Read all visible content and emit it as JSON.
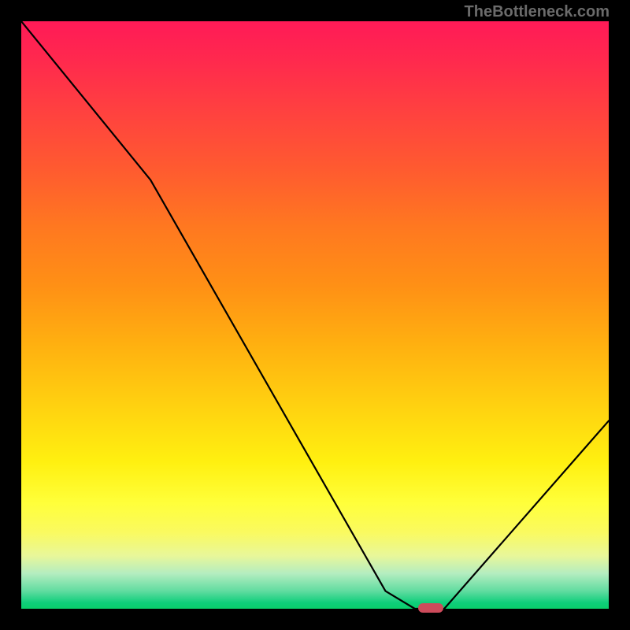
{
  "watermark": "TheBottleneck.com",
  "chart_data": {
    "type": "line",
    "title": "",
    "xlabel": "",
    "ylabel": "",
    "xlim": [
      0,
      100
    ],
    "ylim": [
      0,
      100
    ],
    "x": [
      0,
      22,
      62,
      67,
      72,
      100
    ],
    "bottleneck": [
      100,
      73,
      3,
      0,
      0,
      32
    ],
    "marker": {
      "x": 69.5,
      "y": 0
    },
    "gradient_stops": [
      {
        "pct": 0,
        "color": "#ff1a57"
      },
      {
        "pct": 15,
        "color": "#ff4040"
      },
      {
        "pct": 35,
        "color": "#ff7820"
      },
      {
        "pct": 55,
        "color": "#ffb010"
      },
      {
        "pct": 75,
        "color": "#fff010"
      },
      {
        "pct": 90,
        "color": "#e8f79a"
      },
      {
        "pct": 100,
        "color": "#0ace6a"
      }
    ]
  }
}
